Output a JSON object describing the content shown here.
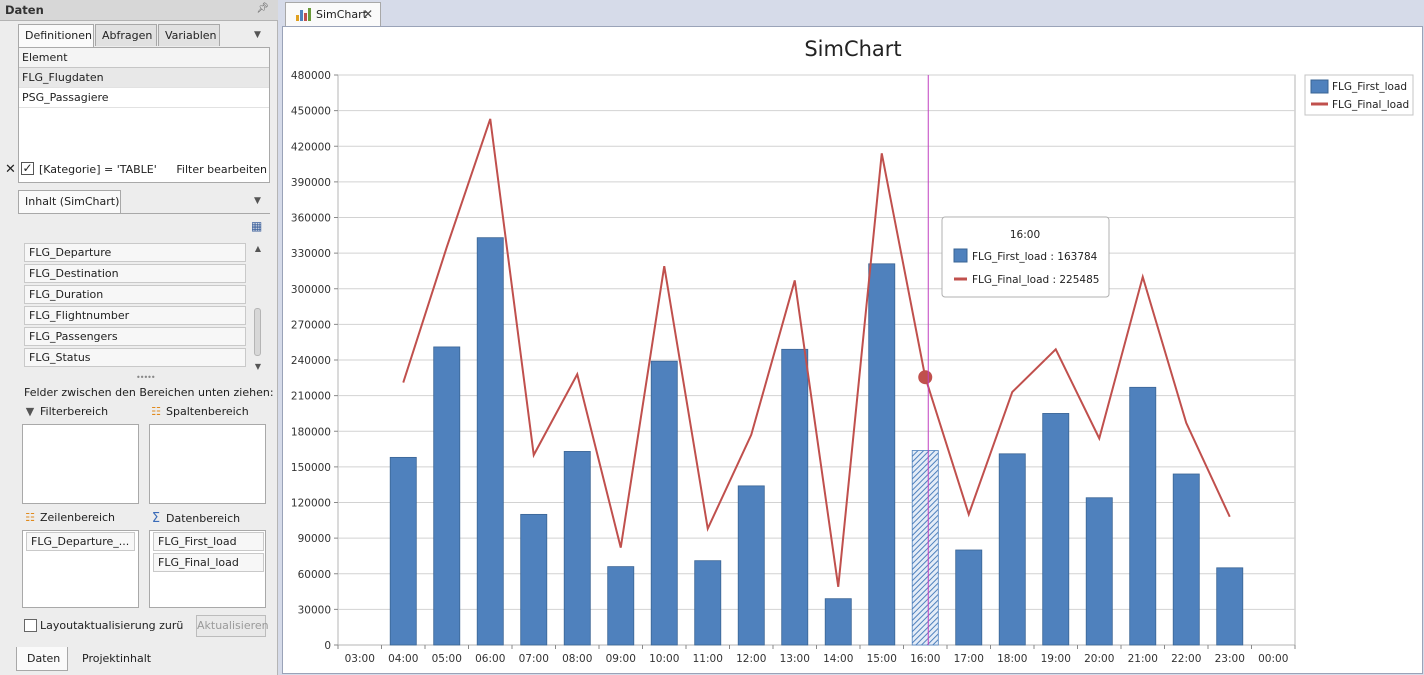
{
  "panel": {
    "title": "Daten",
    "tabs": [
      "Definitionen",
      "Abfragen",
      "Variablen"
    ],
    "grid_header": "Element",
    "elements": [
      "FLG_Flugdaten",
      "PSG_Passagiere"
    ],
    "filter_expr": "[Kategorie] = 'TABLE'",
    "filter_edit": "Filter bearbeiten"
  },
  "content": {
    "tab": "Inhalt (SimChart)",
    "fields": [
      "FLG_Departure",
      "FLG_Destination",
      "FLG_Duration",
      "FLG_Flightnumber",
      "FLG_Passengers",
      "FLG_Status"
    ],
    "drag_hint": "Felder zwischen den Bereichen unten ziehen:",
    "filter_area": "Filterbereich",
    "column_area": "Spaltenbereich",
    "row_area": "Zeilenbereich",
    "data_area": "Datenbereich",
    "row_items": [
      "FLG_Departure_..."
    ],
    "data_items": [
      "FLG_First_load",
      "FLG_Final_load"
    ],
    "layout_label": "Layoutaktualisierung zurückstellen",
    "refresh_label": "Aktualisieren"
  },
  "bottom_tabs": [
    "Daten",
    "Projektinhalt"
  ],
  "doc": {
    "tab_label": "SimChart"
  },
  "colors": {
    "bar": "#4f81bd",
    "line": "#c0504d",
    "crosshair": "#c040c0"
  },
  "chart_data": {
    "type": "bar",
    "title": "SimChart",
    "categories": [
      "03:00",
      "04:00",
      "05:00",
      "06:00",
      "07:00",
      "08:00",
      "09:00",
      "10:00",
      "11:00",
      "12:00",
      "13:00",
      "14:00",
      "15:00",
      "16:00",
      "17:00",
      "18:00",
      "19:00",
      "20:00",
      "21:00",
      "22:00",
      "23:00",
      "00:00"
    ],
    "series": [
      {
        "name": "FLG_First_load",
        "type": "bar",
        "values": [
          null,
          158000,
          251000,
          343000,
          110000,
          163000,
          66000,
          239000,
          71000,
          134000,
          249000,
          39000,
          321000,
          163784,
          80000,
          161000,
          195000,
          124000,
          217000,
          144000,
          65000,
          null
        ]
      },
      {
        "name": "FLG_Final_load",
        "type": "line",
        "values": [
          null,
          221000,
          335000,
          443000,
          160000,
          228000,
          82000,
          319000,
          98000,
          177000,
          307000,
          49000,
          414000,
          225485,
          110000,
          213000,
          249000,
          174000,
          310000,
          187000,
          108000,
          null
        ]
      }
    ],
    "ylim": [
      0,
      480000
    ],
    "yticks": [
      0,
      30000,
      60000,
      90000,
      120000,
      150000,
      180000,
      210000,
      240000,
      270000,
      300000,
      330000,
      360000,
      390000,
      420000,
      450000,
      480000
    ],
    "legend": "top-right",
    "grid": true,
    "tooltip": {
      "title": "16:00",
      "rows": [
        "FLG_First_load : 163784",
        "FLG_Final_load : 225485"
      ],
      "category": "16:00"
    }
  }
}
